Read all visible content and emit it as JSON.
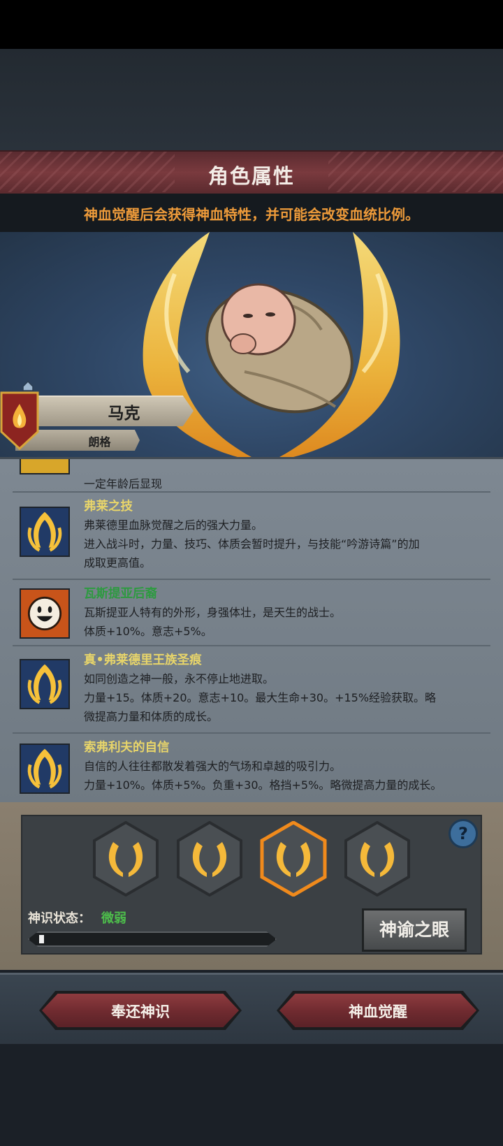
{
  "header": {
    "title": "角色属性",
    "subtitle": "神血觉醒后会获得神血特性，并可能会改变血统比例。"
  },
  "character": {
    "name": "马克",
    "origin": "朗格"
  },
  "traits": [
    {
      "name": "",
      "lines": [
        "一定年龄后显现"
      ],
      "icon": "lock-icon"
    },
    {
      "name": "弗莱之技",
      "lines": [
        "弗莱德里血脉觉醒之后的强大力量。",
        "进入战斗时，力量、技巧、体质会暂时提升，与技能“吟游诗篇”的加",
        "成取更高值。"
      ],
      "icon": "divine-flame-icon"
    },
    {
      "name": "瓦斯提亚后裔",
      "lines": [
        "瓦斯提亚人特有的外形，身强体壮，是天生的战士。",
        "体质+10%。意志+5%。"
      ],
      "icon": "smiley-face-icon"
    },
    {
      "name": "真•弗莱德里王族圣痕",
      "lines": [
        "如同创造之神一般，永不停止地进取。",
        "力量+15。体质+20。意志+10。最大生命+30。+15%经验获取。略",
        "微提高力量和体质的成长。"
      ],
      "icon": "divine-flame-icon"
    },
    {
      "name": "索弗利夫的自信",
      "lines": [
        "自信的人往往都散发着强大的气场和卓越的吸引力。",
        "力量+10%。体质+5%。负重+30。格挡+5%。略微提高力量的成长。"
      ],
      "icon": "divine-flame-icon"
    }
  ],
  "slots": {
    "help_label": "?",
    "state_label": "神识状态：",
    "state_value": "微弱",
    "progress": 0.02,
    "oracle_button": "神谕之眼"
  },
  "buttons": {
    "return_label": "奉还神识",
    "awaken_label": "神血觉醒"
  },
  "colors": {
    "accent_gold": "#f5b93a",
    "subtitle_orange": "#ee9b3a",
    "state_green": "#4dbd4b",
    "button_red": "#7a3035"
  }
}
